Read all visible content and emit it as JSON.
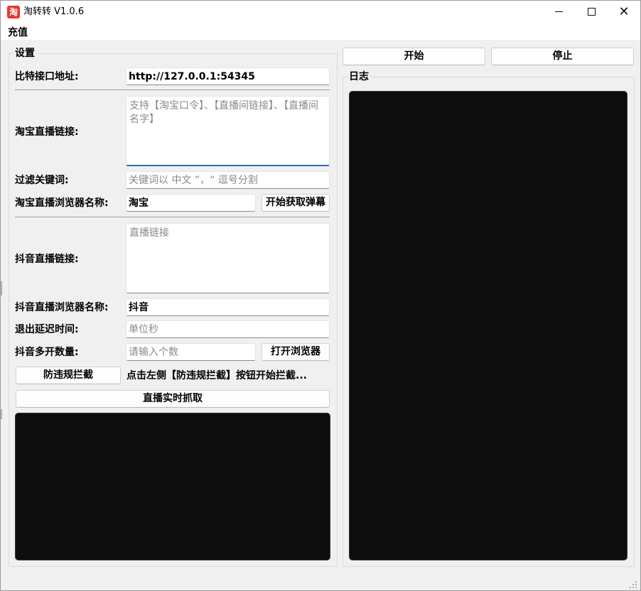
{
  "window": {
    "title": "淘转转 V1.0.6",
    "icon_glyph": "淘",
    "minimize_icon": "minimize-icon",
    "maximize_icon": "maximize-icon",
    "close_icon": "close-icon",
    "close_glyph": "✕"
  },
  "menu": {
    "items": [
      {
        "label": "充值"
      }
    ]
  },
  "settings": {
    "group_title": "设置",
    "bit_api": {
      "label": "比特接口地址:",
      "value": "http://127.0.0.1:54345"
    },
    "taobao_link": {
      "label": "淘宝直播链接:",
      "placeholder": "支持【淘宝口令】、【直播间链接】、【直播间名字】"
    },
    "filter_keywords": {
      "label": "过滤关键词:",
      "placeholder": "关键词以 中文 ”，“ 逗号分割"
    },
    "taobao_browser": {
      "label": "淘宝直播浏览器名称:",
      "value": "淘宝",
      "button": "开始获取弹幕"
    },
    "douyin_link": {
      "label": "抖音直播链接:",
      "placeholder": "直播链接"
    },
    "douyin_browser": {
      "label": "抖音直播浏览器名称:",
      "value": "抖音"
    },
    "exit_delay": {
      "label": "退出延迟时间:",
      "placeholder": "单位秒"
    },
    "douyin_multi": {
      "label": "抖音多开数量:",
      "placeholder": "请输入个数",
      "button": "打开浏览器"
    },
    "anti_block": {
      "button": "防违规拦截",
      "hint": "点击左侧【防违规拦截】按钮开始拦截..."
    },
    "live_capture": {
      "button": "直播实时抓取"
    }
  },
  "controls": {
    "start": "开始",
    "stop": "停止"
  },
  "log": {
    "group_title": "日志"
  },
  "colors": {
    "background": "#f0f0f0",
    "panel": "#0d0d0d",
    "icon_red": "#e8362c",
    "focus_blue": "#2f6eb5"
  }
}
